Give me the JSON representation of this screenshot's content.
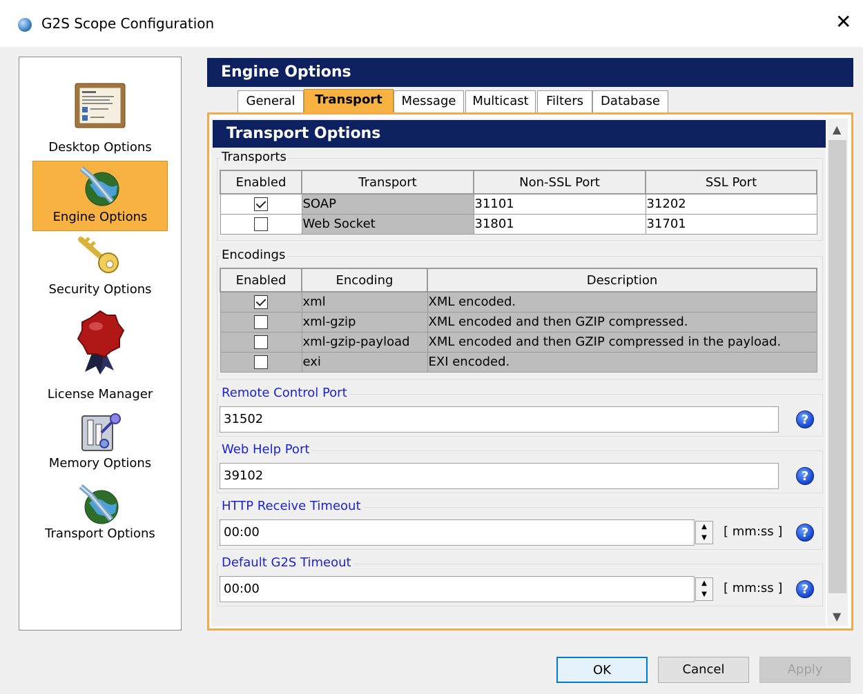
{
  "window": {
    "title": "G2S Scope Configuration",
    "close_glyph": "✕"
  },
  "sidebar": {
    "items": [
      {
        "label": "Desktop Options",
        "icon": "desktop-options-icon"
      },
      {
        "label": "Engine Options",
        "icon": "globe-icon",
        "selected": true
      },
      {
        "label": "Security Options",
        "icon": "key-icon"
      },
      {
        "label": "License Manager",
        "icon": "wax-seal-icon"
      },
      {
        "label": "Memory Options",
        "icon": "memory-switch-icon"
      },
      {
        "label": "Transport Options",
        "icon": "globe-icon"
      }
    ]
  },
  "engine": {
    "header": "Engine Options",
    "tabs": [
      "General",
      "Transport",
      "Message",
      "Multicast",
      "Filters",
      "Database"
    ],
    "active_tab": "Transport"
  },
  "transport": {
    "header": "Transport Options",
    "transports_label": "Transports",
    "transports_columns": [
      "Enabled",
      "Transport",
      "Non-SSL Port",
      "SSL Port"
    ],
    "transports_rows": [
      {
        "enabled": true,
        "transport": "SOAP",
        "non_ssl": "31101",
        "ssl": "31202"
      },
      {
        "enabled": false,
        "transport": "Web Socket",
        "non_ssl": "31801",
        "ssl": "31701"
      }
    ],
    "encodings_label": "Encodings",
    "encodings_columns": [
      "Enabled",
      "Encoding",
      "Description"
    ],
    "encodings_rows": [
      {
        "enabled": true,
        "encoding": "xml",
        "description": "XML encoded."
      },
      {
        "enabled": false,
        "encoding": "xml-gzip",
        "description": "XML encoded and then GZIP compressed."
      },
      {
        "enabled": false,
        "encoding": "xml-gzip-payload",
        "description": "XML encoded and then GZIP compressed in the payload."
      },
      {
        "enabled": false,
        "encoding": "exi",
        "description": "EXI encoded."
      }
    ],
    "remote_control": {
      "label": "Remote Control Port",
      "value": "31502"
    },
    "web_help": {
      "label": "Web Help Port",
      "value": "39102"
    },
    "http_timeout": {
      "label": "HTTP Receive Timeout",
      "value": "00:00",
      "unit": "[ mm:ss ]"
    },
    "g2s_timeout": {
      "label": "Default G2S Timeout",
      "value": "00:00",
      "unit": "[ mm:ss ]"
    },
    "help_glyph": "?"
  },
  "buttons": {
    "ok": "OK",
    "cancel": "Cancel",
    "apply": "Apply"
  },
  "colors": {
    "accent_orange": "#f8b241",
    "header_navy": "#0d2160",
    "label_blue": "#1a22d6"
  }
}
